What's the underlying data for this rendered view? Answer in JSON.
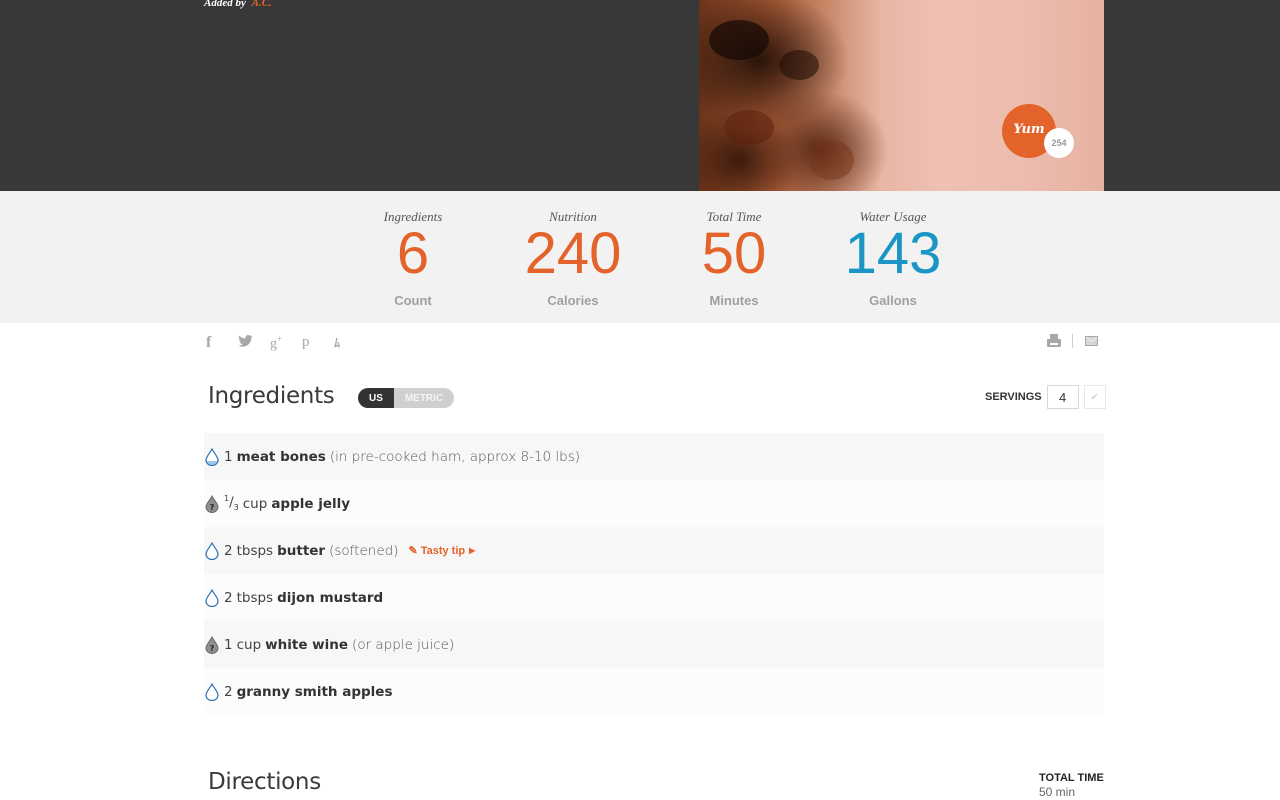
{
  "hero": {
    "added_by_label": "Added by",
    "author": "A.C.",
    "yum_label": "Yum",
    "yum_count": "254"
  },
  "stats": [
    {
      "label": "Ingredients",
      "value": "6",
      "unit": "Count",
      "color": "#e4632a"
    },
    {
      "label": "Nutrition",
      "value": "240",
      "unit": "Calories",
      "color": "#e4632a"
    },
    {
      "label": "Total Time",
      "value": "50",
      "unit": "Minutes",
      "color": "#e4632a"
    },
    {
      "label": "Water Usage",
      "value": "143",
      "unit": "Gallons",
      "color": "#1a95c6"
    }
  ],
  "social": {
    "icons": [
      "facebook-icon",
      "twitter-icon",
      "google-plus-icon",
      "pinterest-icon",
      "stumbleupon-icon"
    ],
    "glyphs": [
      "f",
      "🐦",
      "g+",
      "p",
      "su"
    ]
  },
  "ingredients": {
    "title": "Ingredients",
    "unit_toggle": {
      "us": "US",
      "metric": "METRIC",
      "selected": "US"
    },
    "servings_label": "SERVINGS",
    "servings_value": "4",
    "items": [
      {
        "icon": "water-drop",
        "qty": "1",
        "unit": "",
        "name": "meat bones",
        "note": "(in pre-cooked ham, approx 8-10 lbs)",
        "tip": ""
      },
      {
        "icon": "unknown-drop",
        "qty_num": "1",
        "qty_den": "3",
        "unit": "cup",
        "name": "apple jelly",
        "note": "",
        "tip": ""
      },
      {
        "icon": "water-drop",
        "qty": "2",
        "unit": "tbsps",
        "name": "butter",
        "note": "(softened)",
        "tip": "Tasty tip"
      },
      {
        "icon": "water-drop",
        "qty": "2",
        "unit": "tbsps",
        "name": "dijon mustard",
        "note": "",
        "tip": ""
      },
      {
        "icon": "unknown-drop",
        "qty": "1",
        "unit": "cup",
        "name": "white wine",
        "note": "(or apple juice)",
        "tip": ""
      },
      {
        "icon": "water-drop",
        "qty": "2",
        "unit": "",
        "name": "granny smith apples",
        "note": "",
        "tip": ""
      }
    ]
  },
  "directions": {
    "title": "Directions",
    "total_time_label": "TOTAL TIME",
    "total_time_value": "50 min"
  },
  "colors": {
    "accent_orange": "#e4632a",
    "accent_blue": "#1a95c6",
    "hero_bg": "#383838",
    "stats_bg": "#f2f2f2"
  }
}
